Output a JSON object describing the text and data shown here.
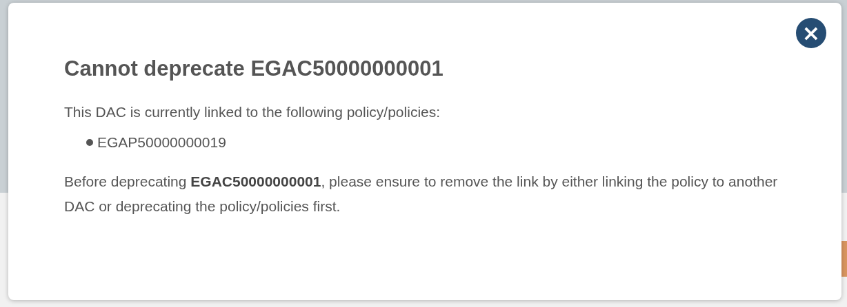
{
  "dialog": {
    "title": "Cannot deprecate EGAC50000000001",
    "intro": "This DAC is currently linked to the following policy/policies:",
    "policies": [
      "EGAP50000000019"
    ],
    "message": "Before deprecating **EGAC50000000001**, please ensure to remove the link by either linking the policy to another DAC or deprecating the policy/policies first.",
    "close_label": "×"
  }
}
